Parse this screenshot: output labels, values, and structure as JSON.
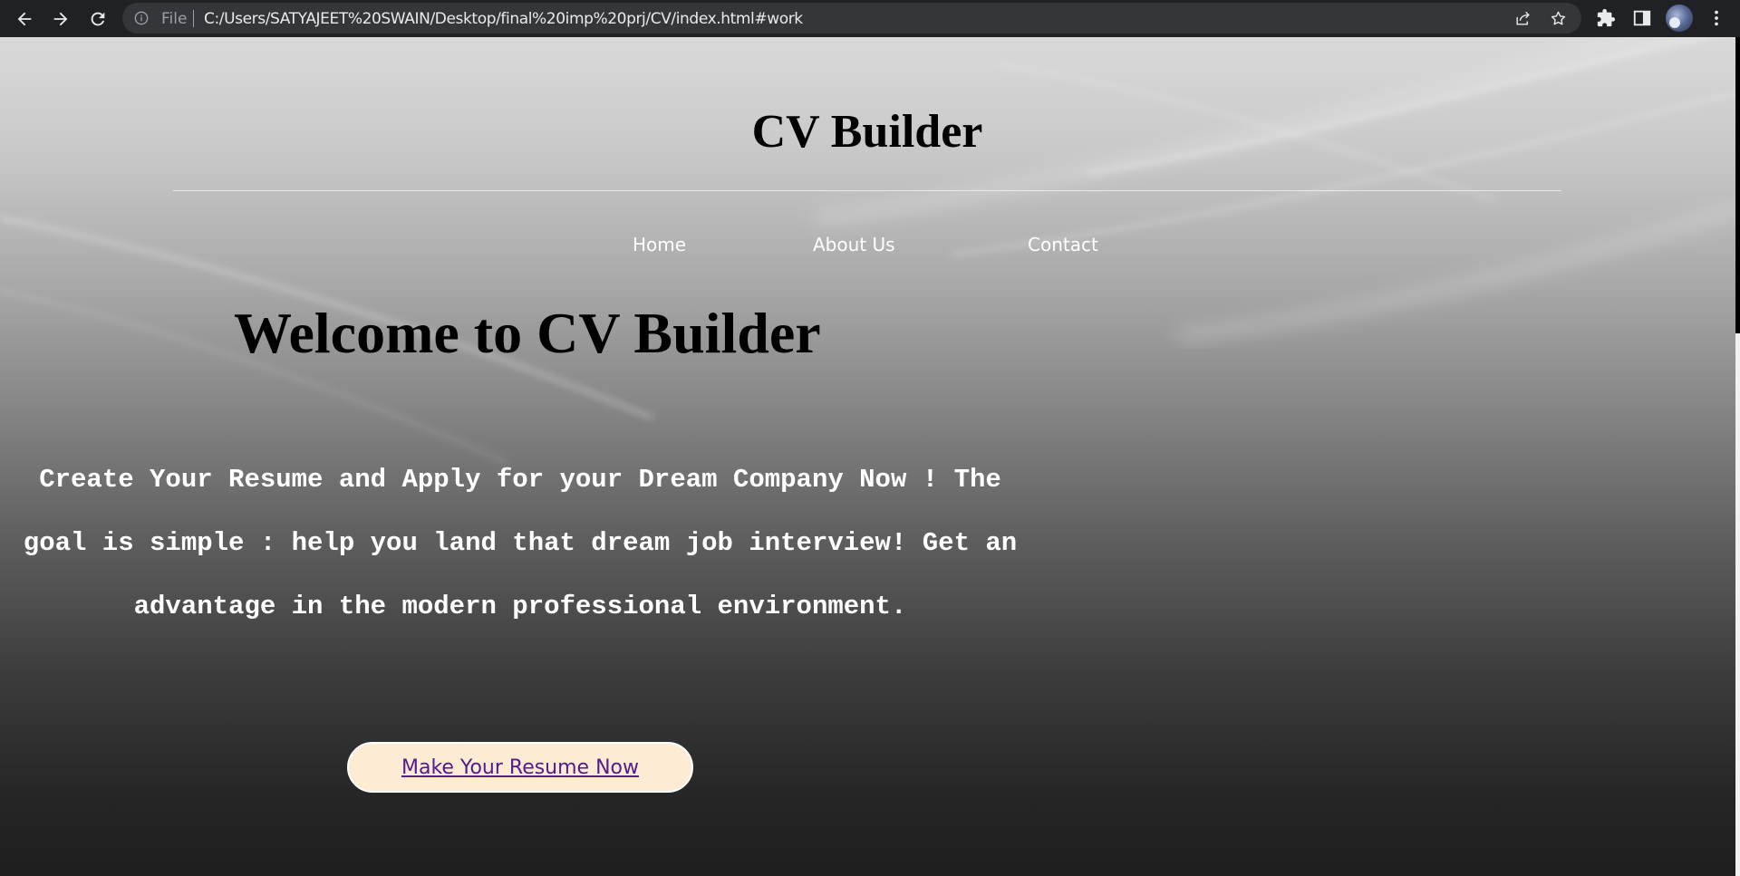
{
  "browser": {
    "file_label": "File",
    "url": "C:/Users/SATYAJEET%20SWAIN/Desktop/final%20imp%20prj/CV/index.html#work"
  },
  "site": {
    "title": "CV Builder",
    "nav": [
      {
        "label": "Home"
      },
      {
        "label": "About Us"
      },
      {
        "label": "Contact"
      }
    ],
    "welcome": "Welcome to CV Builder",
    "tagline_lines": [
      "Create Your Resume and Apply for your Dream Company Now ! The",
      "goal is simple : help you land that dream job interview! Get an",
      "advantage in the modern professional environment."
    ],
    "cta_label": "Make Your Resume Now"
  },
  "colors": {
    "chrome_bg": "#202124",
    "omnibox_bg": "#35363a",
    "cta_bg": "#fdebd3",
    "cta_text": "#551a8b"
  }
}
